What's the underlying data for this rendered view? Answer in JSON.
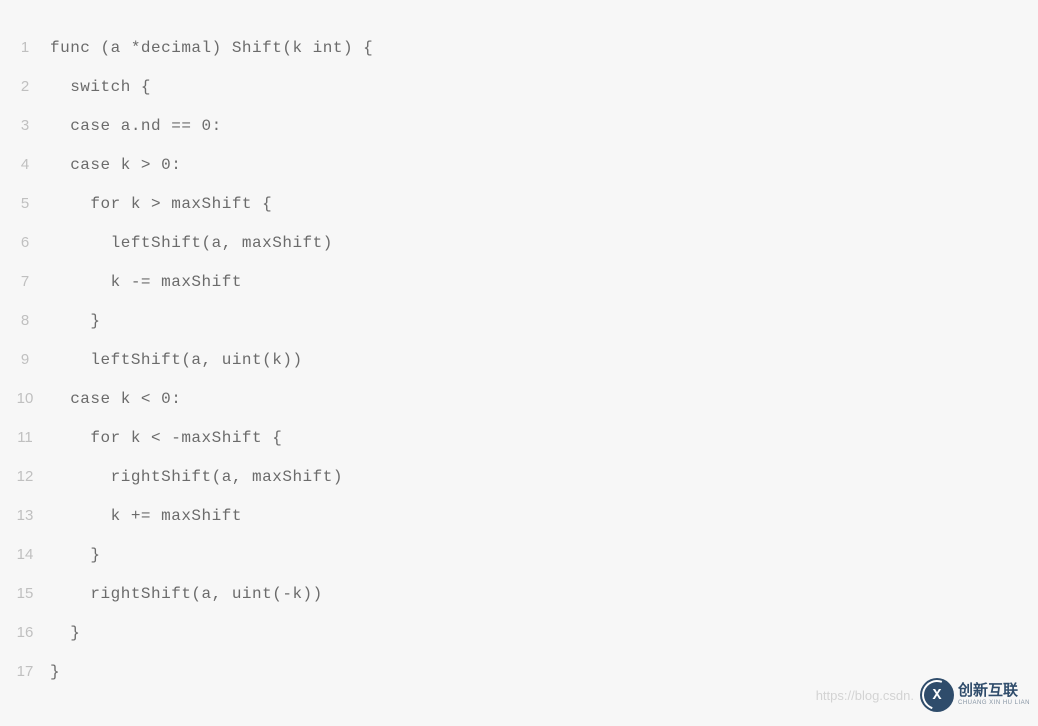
{
  "code": {
    "lines": [
      {
        "num": "1",
        "text": "func (a *decimal) Shift(k int) {"
      },
      {
        "num": "2",
        "text": "  switch {"
      },
      {
        "num": "3",
        "text": "  case a.nd == 0:"
      },
      {
        "num": "4",
        "text": "  case k > 0:"
      },
      {
        "num": "5",
        "text": "    for k > maxShift {"
      },
      {
        "num": "6",
        "text": "      leftShift(a, maxShift)"
      },
      {
        "num": "7",
        "text": "      k -= maxShift"
      },
      {
        "num": "8",
        "text": "    }"
      },
      {
        "num": "9",
        "text": "    leftShift(a, uint(k))"
      },
      {
        "num": "10",
        "text": "  case k < 0:"
      },
      {
        "num": "11",
        "text": "    for k < -maxShift {"
      },
      {
        "num": "12",
        "text": "      rightShift(a, maxShift)"
      },
      {
        "num": "13",
        "text": "      k += maxShift"
      },
      {
        "num": "14",
        "text": "    }"
      },
      {
        "num": "15",
        "text": "    rightShift(a, uint(-k))"
      },
      {
        "num": "16",
        "text": "  }"
      },
      {
        "num": "17",
        "text": "}"
      }
    ]
  },
  "watermark": {
    "url": "https://blog.csdn.",
    "logo_cn": "创新互联",
    "logo_en": "CHUANG XIN HU LIAN",
    "logo_mark": "X"
  }
}
